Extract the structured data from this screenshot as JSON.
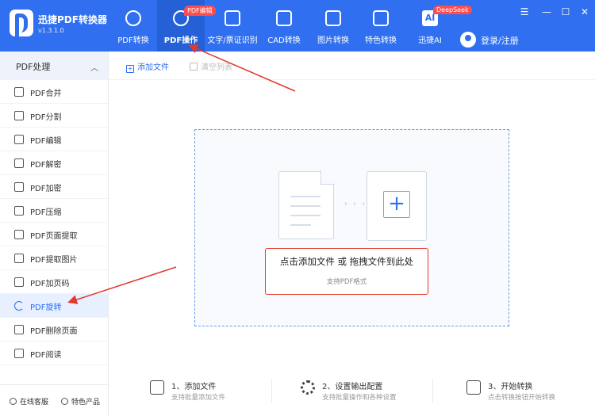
{
  "app": {
    "title": "迅捷PDF转换器",
    "version": "v1.3.1.0"
  },
  "nav": [
    {
      "id": "pdf-convert",
      "label": "PDF转换",
      "icon": "convert-icon"
    },
    {
      "id": "pdf-operate",
      "label": "PDF操作",
      "icon": "pdf-operate-icon",
      "active": true,
      "badge": "PDF编辑"
    },
    {
      "id": "ocr",
      "label": "文字/票证识别",
      "icon": "ocr-icon"
    },
    {
      "id": "cad",
      "label": "CAD转换",
      "icon": "cad-icon"
    },
    {
      "id": "image",
      "label": "图片转换",
      "icon": "image-icon"
    },
    {
      "id": "special",
      "label": "特色转换",
      "icon": "star-icon"
    },
    {
      "id": "ai",
      "label": "迅捷AI",
      "icon": "ai-icon",
      "badge": "DeepSeek",
      "ai_text": "AI"
    }
  ],
  "user": {
    "login_label": "登录/注册"
  },
  "window": {
    "menu": "☰",
    "minimize": "—",
    "maximize": "☐",
    "close": "✕"
  },
  "sidebar": {
    "section": "PDF处理",
    "chevron": "︿",
    "items": [
      {
        "label": "PDF合并",
        "icon": "merge-icon"
      },
      {
        "label": "PDF分割",
        "icon": "split-icon"
      },
      {
        "label": "PDF编辑",
        "icon": "edit-icon"
      },
      {
        "label": "PDF解密",
        "icon": "unlock-icon"
      },
      {
        "label": "PDF加密",
        "icon": "shield-icon"
      },
      {
        "label": "PDF压缩",
        "icon": "compress-icon"
      },
      {
        "label": "PDF页面提取",
        "icon": "page-extract-icon"
      },
      {
        "label": "PDF提取图片",
        "icon": "image-extract-icon"
      },
      {
        "label": "PDF加页码",
        "icon": "page-number-icon"
      },
      {
        "label": "PDF旋转",
        "icon": "rotate-icon",
        "active": true
      },
      {
        "label": "PDF删除页面",
        "icon": "delete-page-icon"
      },
      {
        "label": "PDF阅读",
        "icon": "book-icon"
      }
    ],
    "footer": {
      "service": "在线客服",
      "products": "特色产品"
    }
  },
  "toolbar": {
    "add_file": "添加文件",
    "clear_list": "清空列表"
  },
  "dropzone": {
    "main_text": "点击添加文件 或 拖拽文件到此处",
    "sub_text": "支持PDF格式",
    "dots": "› › ›",
    "plus": "+"
  },
  "steps": [
    {
      "title": "1、添加文件",
      "desc": "支持批量添加文件",
      "icon": "add-file-icon"
    },
    {
      "title": "2、设置输出配置",
      "desc": "支持批量操作和各种设置",
      "icon": "settings-icon"
    },
    {
      "title": "3、开始转换",
      "desc": "点击转换按钮开始转换",
      "icon": "start-convert-icon"
    }
  ],
  "colors": {
    "primary": "#2f6ff0",
    "annotation": "#e03a2f"
  }
}
